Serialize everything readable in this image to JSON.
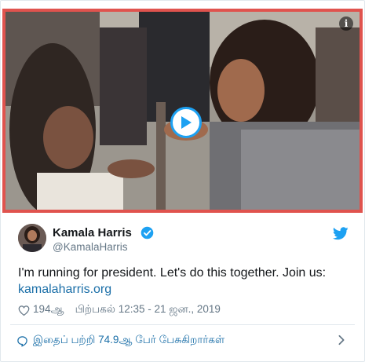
{
  "media": {
    "info_icon": "info-icon",
    "play_icon": "play-icon",
    "info_glyph": "i"
  },
  "tweet": {
    "author_name": "Kamala Harris",
    "author_handle": "@KamalaHarris",
    "verified_icon": "verified-badge-icon",
    "platform_icon": "twitter-bird-icon",
    "text": "I'm running for president. Let's do this together. Join us:",
    "link": "kamalaharris.org",
    "likes": "194ஆ",
    "timestamp": "பிற்பகல் 12:35 - 21 ஜன., 2019",
    "like_icon": "heart-icon"
  },
  "footer": {
    "conversation": "இதைப் பற்றி 74.9ஆ பேர் பேசுகிறார்கள்",
    "reply_icon": "reply-bubble-icon",
    "chevron_icon": "chevron-right-icon"
  },
  "colors": {
    "accent": "#1da1f2",
    "link": "#1b6fa8",
    "frame_border": "#e0534e",
    "muted_text": "#657786"
  }
}
